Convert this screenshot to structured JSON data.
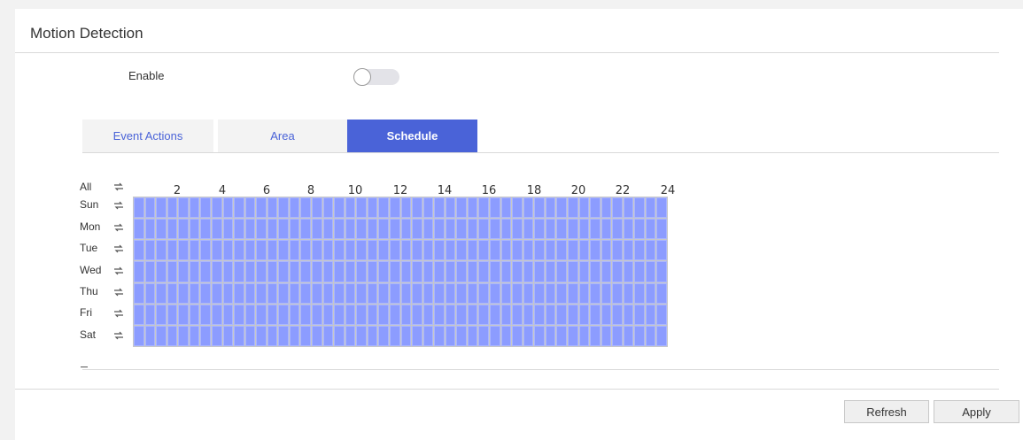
{
  "header": {
    "title": "Motion Detection"
  },
  "enable": {
    "label": "Enable",
    "state": "off"
  },
  "tabs": [
    {
      "label": "Event Actions",
      "active": false
    },
    {
      "label": "Area",
      "active": false
    },
    {
      "label": "Schedule",
      "active": true
    }
  ],
  "schedule": {
    "all_label": "All",
    "days": [
      "Sun",
      "Mon",
      "Tue",
      "Wed",
      "Thu",
      "Fri",
      "Sat"
    ],
    "hour_labels": [
      "2",
      "4",
      "6",
      "8",
      "10",
      "12",
      "14",
      "16",
      "18",
      "20",
      "22",
      "24"
    ],
    "slots_per_day": 48,
    "all_selected": true,
    "selected_color": "#8c9cff",
    "repeat_icon": "repeat-arrows-icon"
  },
  "footer": {
    "refresh_label": "Refresh",
    "apply_label": "Apply"
  },
  "colors": {
    "accent": "#4a63d8",
    "background": "#f2f2f2",
    "panel": "#ffffff"
  }
}
